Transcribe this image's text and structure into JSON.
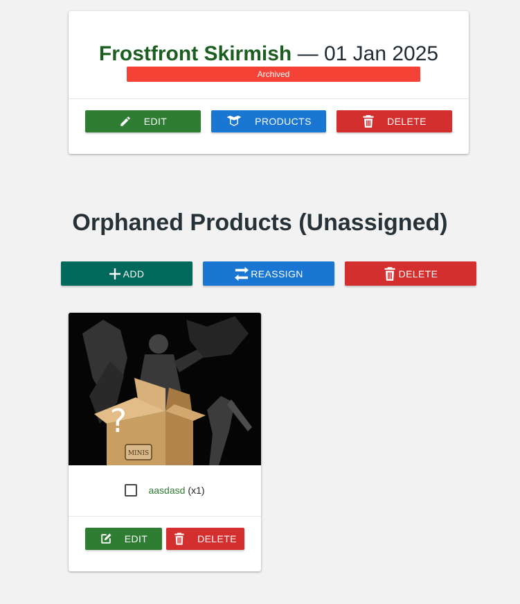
{
  "event": {
    "name": "Frostfront Skirmish",
    "separator": "—",
    "date": "01 Jan 2025",
    "status": "Archived",
    "colors": {
      "name": "#1b5e20",
      "status": "#f44336"
    },
    "buttons": {
      "edit": "EDIT",
      "products": "PRODUCTS",
      "delete": "DELETE"
    }
  },
  "orphaned": {
    "title": "Orphaned Products (Unassigned)",
    "buttons": {
      "add": "ADD",
      "reassign": "REASSIGN",
      "delete": "DELETE"
    },
    "product": {
      "name": "aasdasd",
      "quantity": "(x1)",
      "checked": false,
      "image_icon": "mystery-minis-box-image",
      "box_label": "MINIS",
      "box_mark": "?",
      "buttons": {
        "edit": "EDIT",
        "delete": "DELETE"
      }
    }
  },
  "colors": {
    "green": "#2e7d32",
    "blue": "#1976d2",
    "red": "#d32f2f",
    "teal": "#00695c"
  },
  "icons": {
    "edit": "pencil-icon",
    "products": "box-icon",
    "delete": "trash-icon",
    "add": "plus-icon",
    "reassign": "swap-arrows-icon",
    "product_edit": "edit-square-icon"
  }
}
